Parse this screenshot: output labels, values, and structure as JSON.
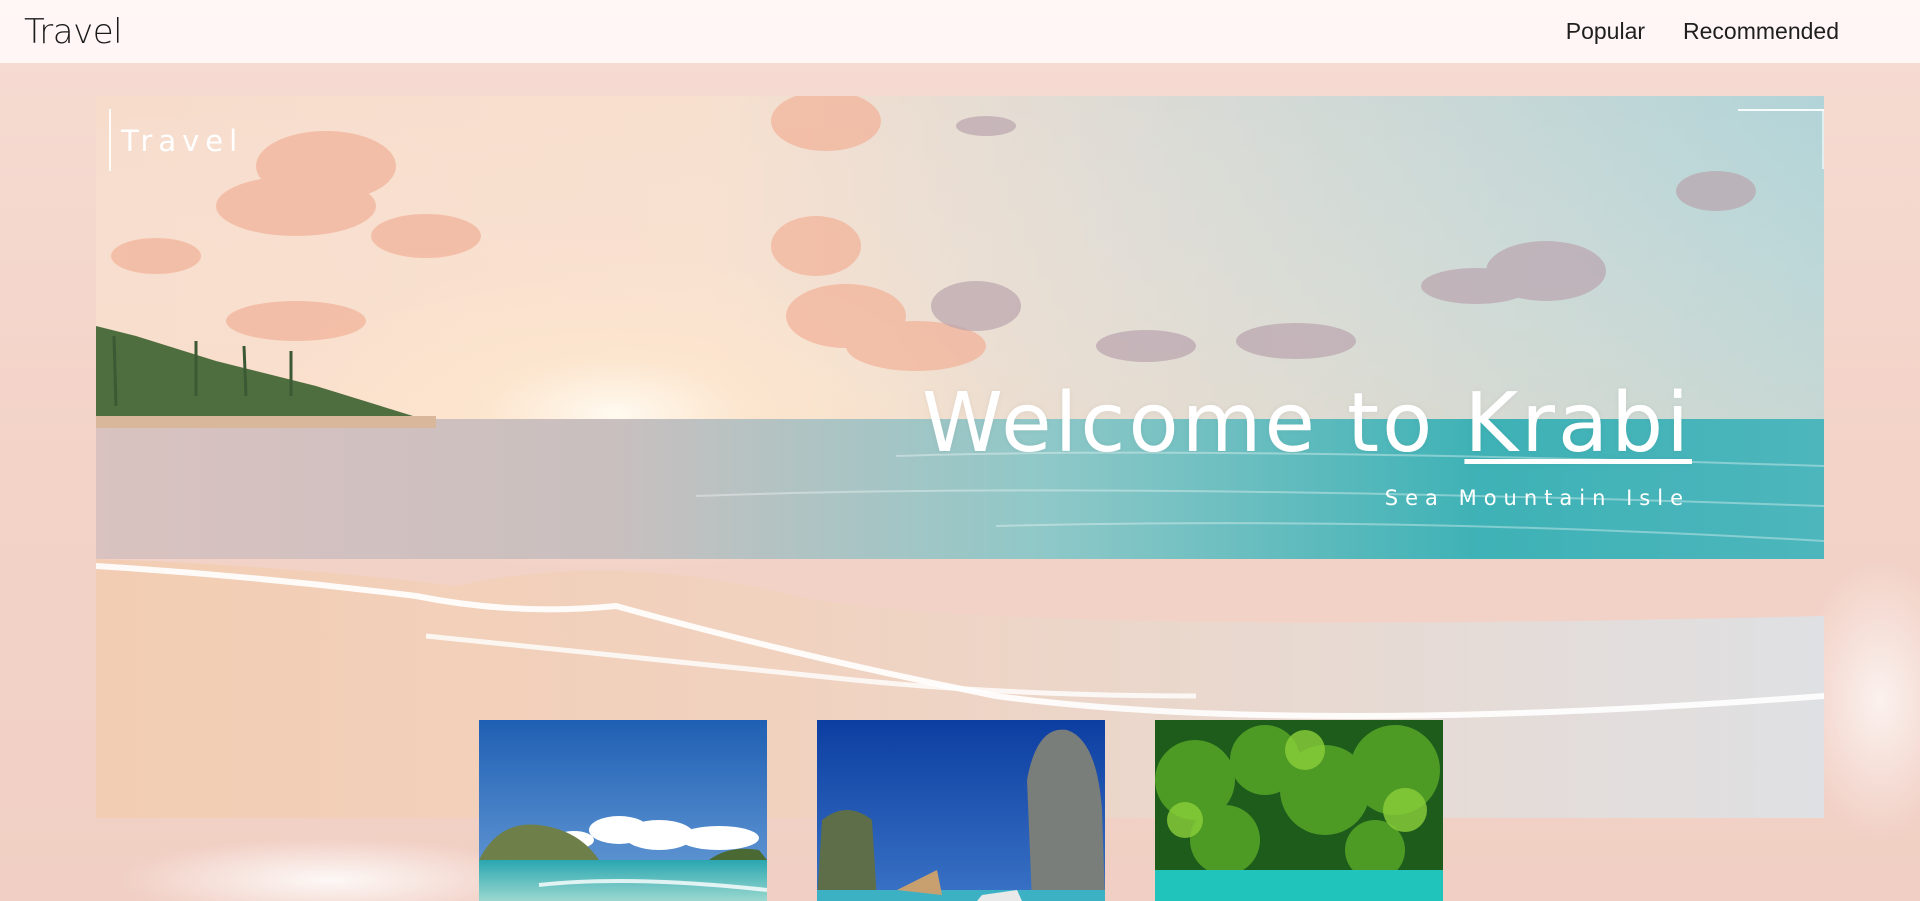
{
  "header": {
    "brand": "Travel",
    "nav": [
      {
        "label": "Popular"
      },
      {
        "label": "Recommended"
      }
    ]
  },
  "hero": {
    "brand": "Travel",
    "title_prefix": "Welcome to ",
    "title_highlight": "Krabi",
    "subtitle": "Sea Mountain Isle",
    "image": "beach-sunset-image"
  },
  "thumbnails": [
    {
      "name": "island-beach-image"
    },
    {
      "name": "limestone-cliffs-boats-image"
    },
    {
      "name": "jungle-lagoon-image"
    }
  ],
  "colors": {
    "page_background": "#f3d3c8",
    "navbar_background": "#fff9f7",
    "hero_text": "#ffffff",
    "nav_text": "#1f1f1f"
  }
}
